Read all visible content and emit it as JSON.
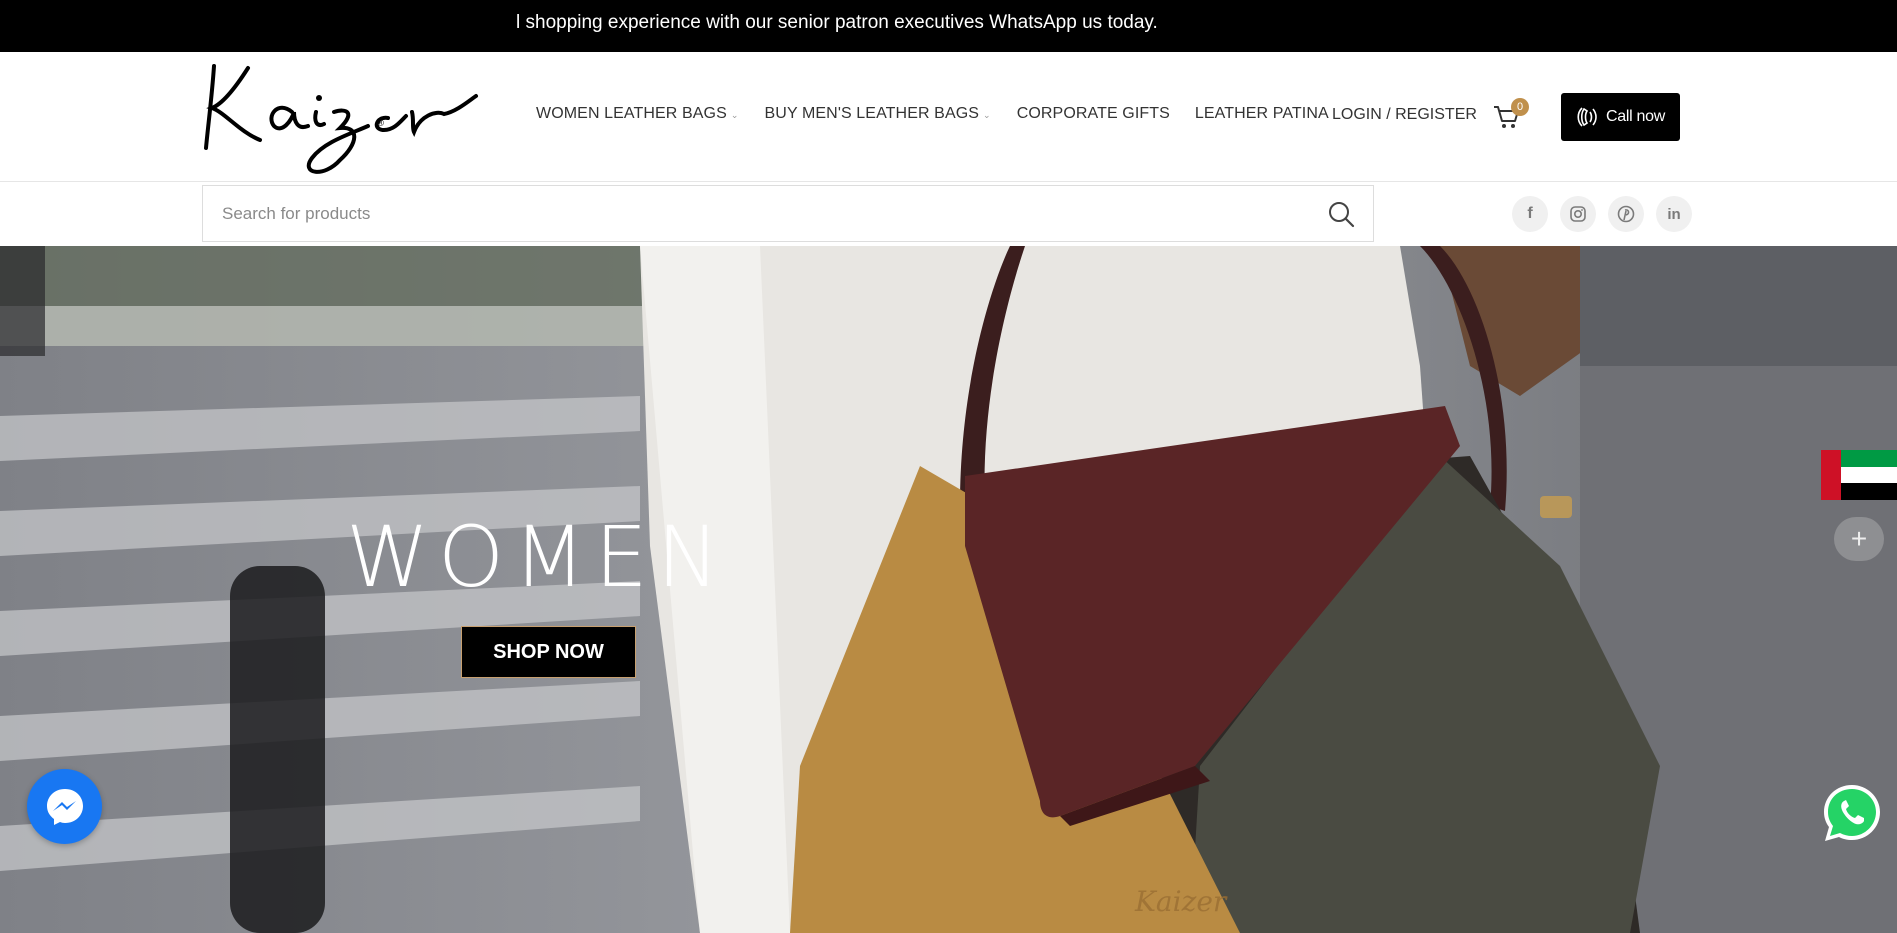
{
  "announcement": "l shopping experience with our senior patron executives WhatsApp us today.",
  "logo": {
    "text": "Kaizer",
    "registered": "®"
  },
  "nav": [
    {
      "label": "WOMEN LEATHER BAGS",
      "has_dropdown": true
    },
    {
      "label": "BUY MEN'S LEATHER BAGS",
      "has_dropdown": true
    },
    {
      "label": "CORPORATE GIFTS",
      "has_dropdown": false
    },
    {
      "label": "LEATHER PATINA",
      "has_dropdown": false
    }
  ],
  "account": {
    "login_label": "LOGIN / REGISTER"
  },
  "cart": {
    "count": "0",
    "icon": "cart-icon"
  },
  "call": {
    "label": "Call now",
    "icon": "phone-ring-icon"
  },
  "search": {
    "placeholder": "Search for products",
    "value": "",
    "icon": "search-icon"
  },
  "socials": [
    {
      "name": "facebook",
      "glyph": "f"
    },
    {
      "name": "instagram",
      "glyph": "◎"
    },
    {
      "name": "pinterest",
      "glyph": "℗"
    },
    {
      "name": "linkedin",
      "glyph": "in"
    }
  ],
  "hero": {
    "title": "WOMEN",
    "button_label": "SHOP NOW"
  },
  "widgets": {
    "messenger_icon": "messenger-icon",
    "whatsapp_icon": "whatsapp-icon",
    "flag_icon": "uae-flag-icon",
    "plus_label": "+"
  },
  "colors": {
    "topbar": "#000000",
    "cart_badge": "#c0904c",
    "messenger": "#1877f2",
    "whatsapp": "#25d366"
  }
}
